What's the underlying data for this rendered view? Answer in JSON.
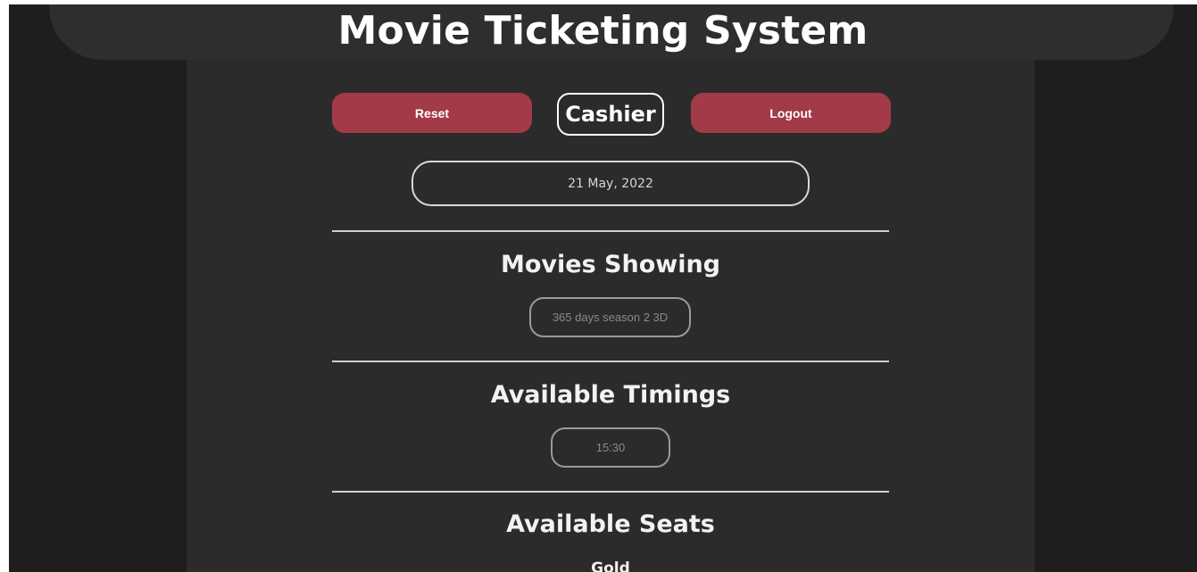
{
  "header": {
    "title": "Movie Ticketing System"
  },
  "toolbar": {
    "reset_label": "Reset",
    "role_label": "Cashier",
    "logout_label": "Logout"
  },
  "date": {
    "value": "21 May, 2022"
  },
  "sections": {
    "movies": {
      "title": "Movies Showing",
      "items": [
        "365 days season 2 3D"
      ]
    },
    "timings": {
      "title": "Available Timings",
      "items": [
        "15:30"
      ]
    },
    "seats": {
      "title": "Available Seats",
      "classes": [
        "Gold"
      ]
    }
  },
  "colors": {
    "background": "#1e1e1e",
    "panel": "#2b2b2b",
    "header_bar": "#2e2e2f",
    "accent_red": "#a23a47",
    "text": "#ffffff"
  }
}
